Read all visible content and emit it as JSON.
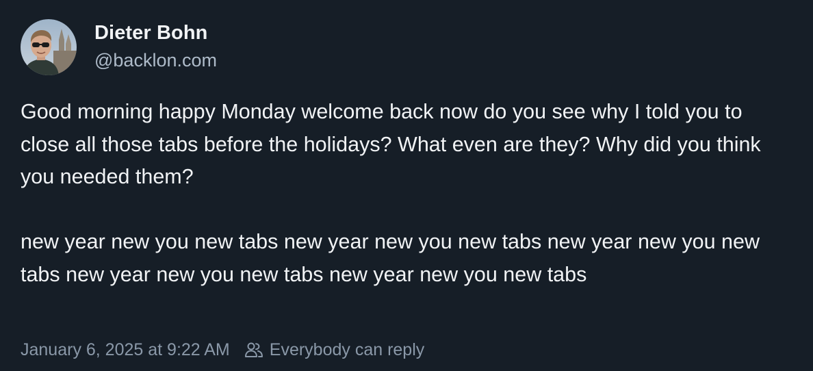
{
  "author": {
    "display_name": "Dieter Bohn",
    "handle": "@backlon.com",
    "avatar_icon": "user-avatar-photo"
  },
  "post": {
    "paragraphs": [
      "Good morning happy Monday welcome back now do you see why I told you to close all those tabs before the holidays? What even are they? Why did you think you needed them?",
      "new year new you new tabs new year new you new tabs new year new you new tabs new year new you new tabs new year new you new tabs"
    ]
  },
  "meta": {
    "timestamp": "January 6, 2025 at 9:22 AM",
    "reply_setting": "Everybody can reply",
    "reply_icon": "people-icon"
  },
  "colors": {
    "background": "#161e27",
    "text_primary": "#f1f3f5",
    "text_secondary": "#aebbc9",
    "text_meta": "#8a98a8"
  }
}
